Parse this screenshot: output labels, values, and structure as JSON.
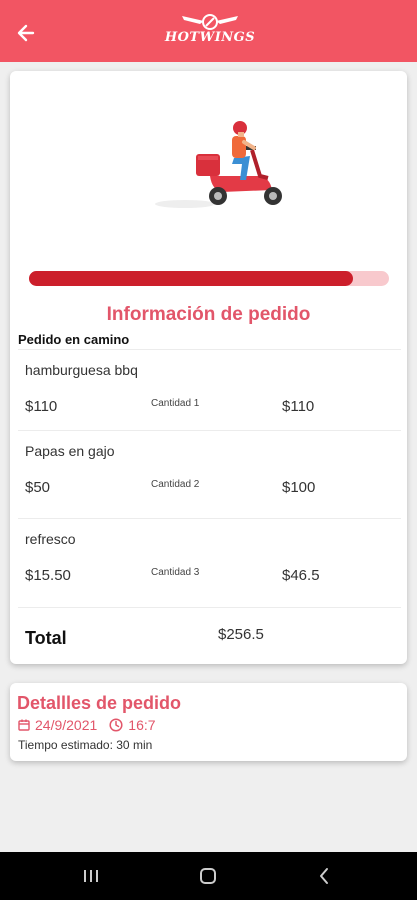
{
  "header": {
    "back_icon": "arrow-left-icon",
    "logo_text": "HOTWINGS",
    "logo_icon": "winged-emblem-icon",
    "background": "#f25563"
  },
  "order": {
    "illustration": "delivery-scooter-illustration",
    "progress": 0.9,
    "title": "Información de pedido",
    "status": "Pedido en camino",
    "items": [
      {
        "name": "hamburguesa bbq",
        "price": "$110",
        "quantity": "Cantidad 1",
        "subtotal": "$110"
      },
      {
        "name": "Papas en gajo",
        "price": "$50",
        "quantity": "Cantidad 2",
        "subtotal": "$100"
      },
      {
        "name": "refresco",
        "price": "$15.50",
        "quantity": "Cantidad 3",
        "subtotal": "$46.5"
      }
    ],
    "total_label": "Total",
    "total_value": "$256.5"
  },
  "details": {
    "title": "Detallles de pedido",
    "date_icon": "calendar-icon",
    "date": "24/9/2021",
    "time_icon": "clock-icon",
    "time": "16:7",
    "eta": "Tiempo estimado: 30 min"
  },
  "system_nav": {
    "recents_icon": "recents-icon",
    "home_icon": "home-icon",
    "back_icon": "back-chevron-icon"
  },
  "colors": {
    "accent": "#e2566a",
    "progress_fill": "#cc1f2b",
    "progress_track": "#f8c9cd"
  }
}
